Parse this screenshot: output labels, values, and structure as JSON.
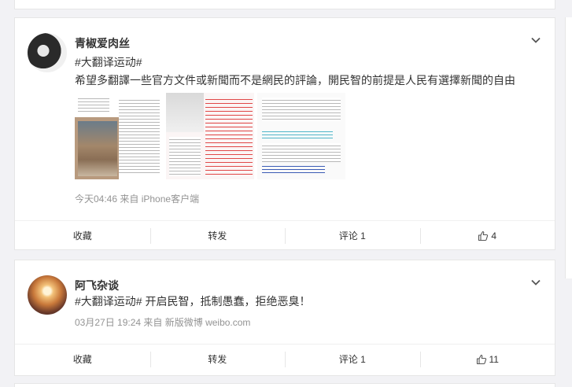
{
  "posts": [
    {
      "username": "青椒爱肉丝",
      "hashtag": "#大翻译运动#",
      "text": "希望多翻譯一些官方文件或新聞而不是網民的評論，開民智的前提是人民有選擇新聞的自由",
      "time": "今天04:46",
      "source": "来自 iPhone客户端",
      "actions": {
        "favorite": "收藏",
        "repost": "转发",
        "comment": "评论 1",
        "like": "4"
      },
      "images": [
        "image-1",
        "image-2",
        "image-3"
      ]
    },
    {
      "username": "阿飞杂谈",
      "hashtag": "#大翻译运动#",
      "text": " 开启民智，抵制愚蠢，拒绝恶臭！",
      "time": "03月27日 19:24",
      "source": "来自 新版微博 weibo.com",
      "actions": {
        "favorite": "收藏",
        "repost": "转发",
        "comment": "评论 1",
        "like": "11"
      }
    }
  ],
  "icons": {
    "chevron": "chevron-down-icon",
    "like": "thumbs-up-icon"
  },
  "colors": {
    "background": "#f2f2f5",
    "card": "#ffffff",
    "meta": "#939393",
    "text": "#333333"
  }
}
